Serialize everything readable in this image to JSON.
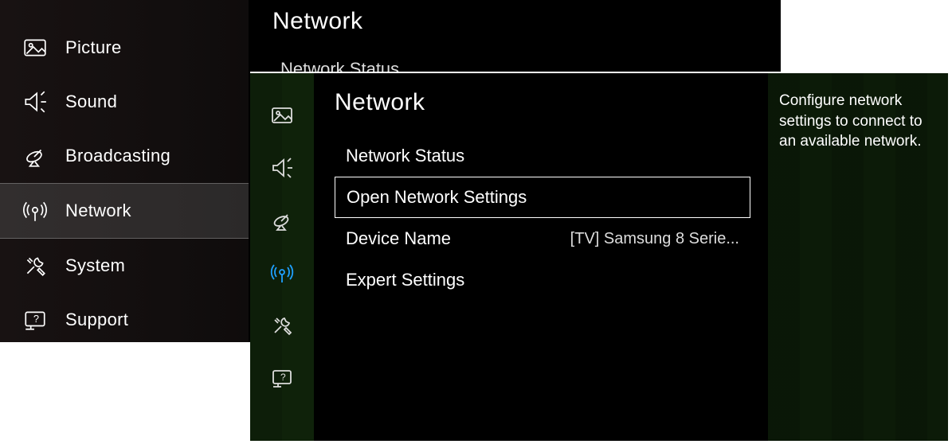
{
  "colors": {
    "accent": "#1fa0ff",
    "text": "#ffffff",
    "bg": "#000000"
  },
  "back": {
    "title": "Network",
    "partial_item": "Network Status",
    "sidebar": {
      "items": [
        {
          "label": "Picture",
          "icon": "picture-icon"
        },
        {
          "label": "Sound",
          "icon": "sound-icon"
        },
        {
          "label": "Broadcasting",
          "icon": "satellite-icon"
        },
        {
          "label": "Network",
          "icon": "antenna-icon",
          "selected": true
        },
        {
          "label": "System",
          "icon": "tools-icon"
        },
        {
          "label": "Support",
          "icon": "support-icon"
        }
      ]
    }
  },
  "front": {
    "title": "Network",
    "help_text": "Configure network settings to connect to an available network.",
    "active_icon": "antenna-icon",
    "menu": [
      {
        "label": "Network Status",
        "value": ""
      },
      {
        "label": "Open Network Settings",
        "value": "",
        "outlined": true
      },
      {
        "label": "Device Name",
        "value": "[TV] Samsung 8 Serie..."
      },
      {
        "label": "Expert Settings",
        "value": ""
      }
    ]
  }
}
